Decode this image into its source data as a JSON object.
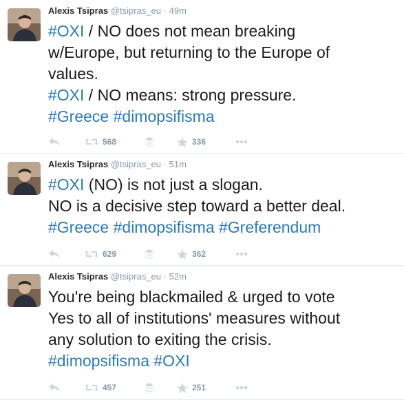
{
  "tweets": [
    {
      "name": "Alexis Tsipras",
      "handle": "@tsipras_eu",
      "separator": "·",
      "time": "49m",
      "lines": [
        [
          {
            "t": "#OXI",
            "tag": true
          },
          {
            "t": " / NO does not mean breaking"
          }
        ],
        [
          {
            "t": "w/Europe, but returning to the Europe of"
          }
        ],
        [
          {
            "t": "values."
          }
        ],
        [
          {
            "t": "#OXI",
            "tag": true
          },
          {
            "t": " / NO means: strong pressure."
          }
        ],
        [
          {
            "t": "#Greece",
            "tag": true
          },
          {
            "t": " "
          },
          {
            "t": "#dimopsifisma",
            "tag": true
          }
        ]
      ],
      "retweets": "568",
      "favorites": "336"
    },
    {
      "name": "Alexis Tsipras",
      "handle": "@tsipras_eu",
      "separator": "·",
      "time": "51m",
      "lines": [
        [
          {
            "t": "#OXI",
            "tag": true
          },
          {
            "t": " (NO) is not just a slogan."
          }
        ],
        [
          {
            "t": "NO is a decisive step toward a better deal."
          }
        ],
        [
          {
            "t": "#Greece",
            "tag": true
          },
          {
            "t": " "
          },
          {
            "t": "#dimopsifisma",
            "tag": true
          },
          {
            "t": " "
          },
          {
            "t": "#Greferendum",
            "tag": true
          }
        ]
      ],
      "retweets": "629",
      "favorites": "362"
    },
    {
      "name": "Alexis Tsipras",
      "handle": "@tsipras_eu",
      "separator": "·",
      "time": "52m",
      "lines": [
        [
          {
            "t": "You're being blackmailed & urged to vote"
          }
        ],
        [
          {
            "t": "Yes to all of institutions' measures without"
          }
        ],
        [
          {
            "t": "any solution to exiting the crisis."
          }
        ],
        [
          {
            "t": "#dimopsifisma",
            "tag": true
          },
          {
            "t": " "
          },
          {
            "t": "#OXI",
            "tag": true
          }
        ]
      ],
      "retweets": "457",
      "favorites": "251"
    }
  ],
  "colors": {
    "hashtag": "#2b7bb9",
    "meta": "#8899a6",
    "text": "#1b1b1b",
    "divider": "#e1e8ed"
  },
  "icons": {
    "reply": "reply-icon",
    "retweet": "retweet-icon",
    "buffer": "stack-icon",
    "favorite": "star-icon",
    "more": "more-icon"
  }
}
